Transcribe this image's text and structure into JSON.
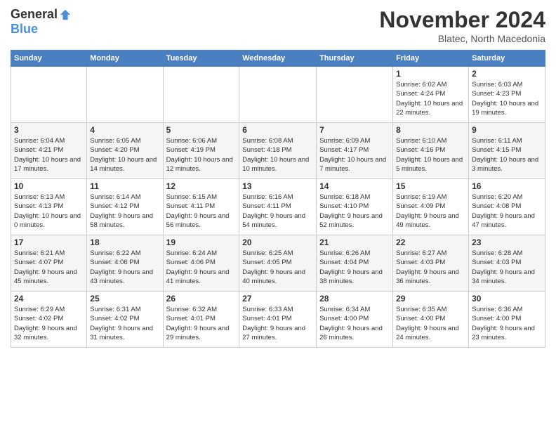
{
  "logo": {
    "general": "General",
    "blue": "Blue"
  },
  "header": {
    "title": "November 2024",
    "location": "Blatec, North Macedonia"
  },
  "days_of_week": [
    "Sunday",
    "Monday",
    "Tuesday",
    "Wednesday",
    "Thursday",
    "Friday",
    "Saturday"
  ],
  "weeks": [
    [
      {
        "day": "",
        "info": ""
      },
      {
        "day": "",
        "info": ""
      },
      {
        "day": "",
        "info": ""
      },
      {
        "day": "",
        "info": ""
      },
      {
        "day": "",
        "info": ""
      },
      {
        "day": "1",
        "info": "Sunrise: 6:02 AM\nSunset: 4:24 PM\nDaylight: 10 hours and 22 minutes."
      },
      {
        "day": "2",
        "info": "Sunrise: 6:03 AM\nSunset: 4:23 PM\nDaylight: 10 hours and 19 minutes."
      }
    ],
    [
      {
        "day": "3",
        "info": "Sunrise: 6:04 AM\nSunset: 4:21 PM\nDaylight: 10 hours and 17 minutes."
      },
      {
        "day": "4",
        "info": "Sunrise: 6:05 AM\nSunset: 4:20 PM\nDaylight: 10 hours and 14 minutes."
      },
      {
        "day": "5",
        "info": "Sunrise: 6:06 AM\nSunset: 4:19 PM\nDaylight: 10 hours and 12 minutes."
      },
      {
        "day": "6",
        "info": "Sunrise: 6:08 AM\nSunset: 4:18 PM\nDaylight: 10 hours and 10 minutes."
      },
      {
        "day": "7",
        "info": "Sunrise: 6:09 AM\nSunset: 4:17 PM\nDaylight: 10 hours and 7 minutes."
      },
      {
        "day": "8",
        "info": "Sunrise: 6:10 AM\nSunset: 4:16 PM\nDaylight: 10 hours and 5 minutes."
      },
      {
        "day": "9",
        "info": "Sunrise: 6:11 AM\nSunset: 4:15 PM\nDaylight: 10 hours and 3 minutes."
      }
    ],
    [
      {
        "day": "10",
        "info": "Sunrise: 6:13 AM\nSunset: 4:13 PM\nDaylight: 10 hours and 0 minutes."
      },
      {
        "day": "11",
        "info": "Sunrise: 6:14 AM\nSunset: 4:12 PM\nDaylight: 9 hours and 58 minutes."
      },
      {
        "day": "12",
        "info": "Sunrise: 6:15 AM\nSunset: 4:11 PM\nDaylight: 9 hours and 56 minutes."
      },
      {
        "day": "13",
        "info": "Sunrise: 6:16 AM\nSunset: 4:11 PM\nDaylight: 9 hours and 54 minutes."
      },
      {
        "day": "14",
        "info": "Sunrise: 6:18 AM\nSunset: 4:10 PM\nDaylight: 9 hours and 52 minutes."
      },
      {
        "day": "15",
        "info": "Sunrise: 6:19 AM\nSunset: 4:09 PM\nDaylight: 9 hours and 49 minutes."
      },
      {
        "day": "16",
        "info": "Sunrise: 6:20 AM\nSunset: 4:08 PM\nDaylight: 9 hours and 47 minutes."
      }
    ],
    [
      {
        "day": "17",
        "info": "Sunrise: 6:21 AM\nSunset: 4:07 PM\nDaylight: 9 hours and 45 minutes."
      },
      {
        "day": "18",
        "info": "Sunrise: 6:22 AM\nSunset: 4:06 PM\nDaylight: 9 hours and 43 minutes."
      },
      {
        "day": "19",
        "info": "Sunrise: 6:24 AM\nSunset: 4:06 PM\nDaylight: 9 hours and 41 minutes."
      },
      {
        "day": "20",
        "info": "Sunrise: 6:25 AM\nSunset: 4:05 PM\nDaylight: 9 hours and 40 minutes."
      },
      {
        "day": "21",
        "info": "Sunrise: 6:26 AM\nSunset: 4:04 PM\nDaylight: 9 hours and 38 minutes."
      },
      {
        "day": "22",
        "info": "Sunrise: 6:27 AM\nSunset: 4:03 PM\nDaylight: 9 hours and 36 minutes."
      },
      {
        "day": "23",
        "info": "Sunrise: 6:28 AM\nSunset: 4:03 PM\nDaylight: 9 hours and 34 minutes."
      }
    ],
    [
      {
        "day": "24",
        "info": "Sunrise: 6:29 AM\nSunset: 4:02 PM\nDaylight: 9 hours and 32 minutes."
      },
      {
        "day": "25",
        "info": "Sunrise: 6:31 AM\nSunset: 4:02 PM\nDaylight: 9 hours and 31 minutes."
      },
      {
        "day": "26",
        "info": "Sunrise: 6:32 AM\nSunset: 4:01 PM\nDaylight: 9 hours and 29 minutes."
      },
      {
        "day": "27",
        "info": "Sunrise: 6:33 AM\nSunset: 4:01 PM\nDaylight: 9 hours and 27 minutes."
      },
      {
        "day": "28",
        "info": "Sunrise: 6:34 AM\nSunset: 4:00 PM\nDaylight: 9 hours and 26 minutes."
      },
      {
        "day": "29",
        "info": "Sunrise: 6:35 AM\nSunset: 4:00 PM\nDaylight: 9 hours and 24 minutes."
      },
      {
        "day": "30",
        "info": "Sunrise: 6:36 AM\nSunset: 4:00 PM\nDaylight: 9 hours and 23 minutes."
      }
    ]
  ]
}
